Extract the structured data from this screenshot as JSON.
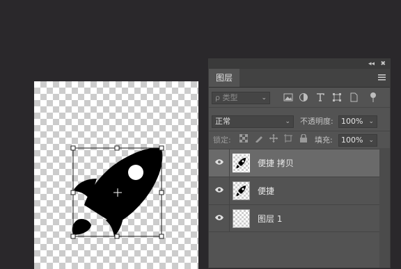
{
  "panel": {
    "tab_label": "图层",
    "collapse_glyph": "◂◂",
    "close_glyph": "✖",
    "filter": {
      "kind_placeholder": "ρ 类型",
      "caret": "⌄"
    },
    "blend": {
      "mode": "正常",
      "caret": "⌄",
      "opacity_label": "不透明度:",
      "opacity_value": "100%"
    },
    "lock": {
      "label": "锁定:",
      "fill_label": "填充:",
      "fill_value": "100%"
    },
    "layers": [
      {
        "name": "便捷 拷贝",
        "visible": true,
        "selected": true
      },
      {
        "name": "便捷",
        "visible": true,
        "selected": false
      },
      {
        "name": "图层 1",
        "visible": true,
        "selected": false
      }
    ]
  },
  "canvas": {
    "shape": "rocket-icon",
    "transform_box": "free-transform-handles"
  },
  "colors": {
    "workspace": "#2a282b",
    "panel": "#535353",
    "selected_layer": "#6a6a6a"
  }
}
